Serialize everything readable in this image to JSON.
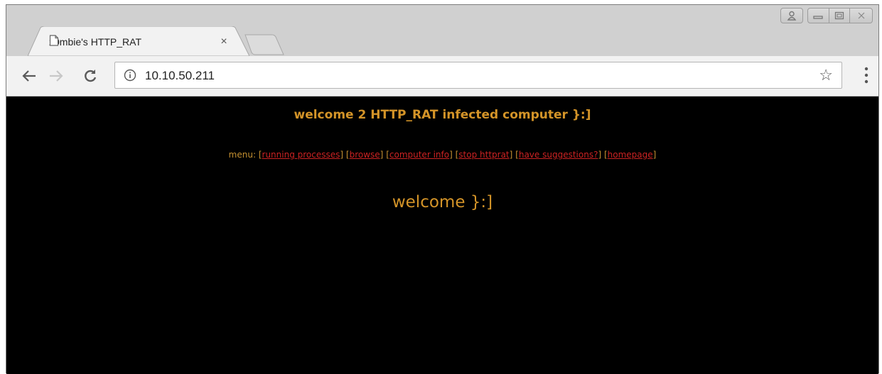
{
  "tab": {
    "title": "z0mbie's HTTP_RAT",
    "close_label": "×"
  },
  "window_controls": {
    "user_icon": "user-icon",
    "minimize_icon": "minimize-icon",
    "maximize_icon": "maximize-icon",
    "close_icon": "close-icon"
  },
  "toolbar": {
    "url": "10.10.50.211",
    "bookmark_icon": "star-icon"
  },
  "page": {
    "headline": "welcome 2 HTTP_RAT infected computer }:]",
    "menu_prefix": "menu:",
    "menu_items": [
      {
        "label": "running processes"
      },
      {
        "label": "browse"
      },
      {
        "label": "computer info"
      },
      {
        "label": "stop httprat"
      },
      {
        "label": "have suggestions?"
      },
      {
        "label": "homepage"
      }
    ],
    "welcome": "welcome }:]"
  },
  "colors": {
    "page_background": "#000000",
    "text_gold": "#d49428",
    "link_red": "#cc2222"
  }
}
